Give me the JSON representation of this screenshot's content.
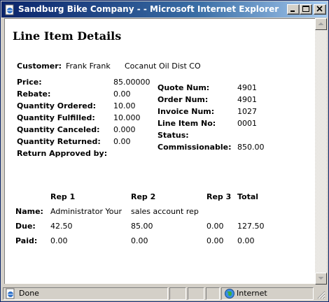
{
  "window": {
    "title": "Sandburg Bike Company - - Microsoft Internet Explorer"
  },
  "page": {
    "title": "Line Item Details",
    "customer": {
      "label": "Customer:",
      "name": "Frank Frank",
      "company": "Cocanut Oil Dist CO"
    },
    "left_fields": [
      {
        "label": "Price:",
        "value": "85.00000"
      },
      {
        "label": "Rebate:",
        "value": "0.00"
      },
      {
        "label": "Quantity Ordered:",
        "value": "10.00"
      },
      {
        "label": "Quantity Fulfilled:",
        "value": "10.000"
      },
      {
        "label": "Quantity Canceled:",
        "value": "0.000"
      },
      {
        "label": "Quantity Returned:",
        "value": "0.00"
      },
      {
        "label": "Return Approved by:",
        "value": ""
      }
    ],
    "right_fields": [
      {
        "label": "Quote Num:",
        "value": "4901"
      },
      {
        "label": "Order Num:",
        "value": "4901"
      },
      {
        "label": "Invoice Num:",
        "value": "1027"
      },
      {
        "label": "Line Item No:",
        "value": "0001"
      },
      {
        "label": "Status:",
        "value": ""
      },
      {
        "label": "Commissionable:",
        "value": "850.00"
      }
    ],
    "reps": {
      "headers": [
        "Rep 1",
        "Rep 2",
        "Rep 3",
        "Total"
      ],
      "rows": [
        {
          "label": "Name:",
          "values": [
            "Administrator Your",
            "sales account rep",
            "",
            ""
          ]
        },
        {
          "label": "Due:",
          "values": [
            "42.50",
            "85.00",
            "0.00",
            "127.50"
          ]
        },
        {
          "label": "Paid:",
          "values": [
            "0.00",
            "0.00",
            "0.00",
            "0.00"
          ]
        }
      ]
    }
  },
  "status_bar": {
    "status": "Done",
    "zone": "Internet"
  },
  "icons": {
    "window": "ie-page-icon",
    "status": "page-done-icon",
    "zone": "globe-icon"
  }
}
